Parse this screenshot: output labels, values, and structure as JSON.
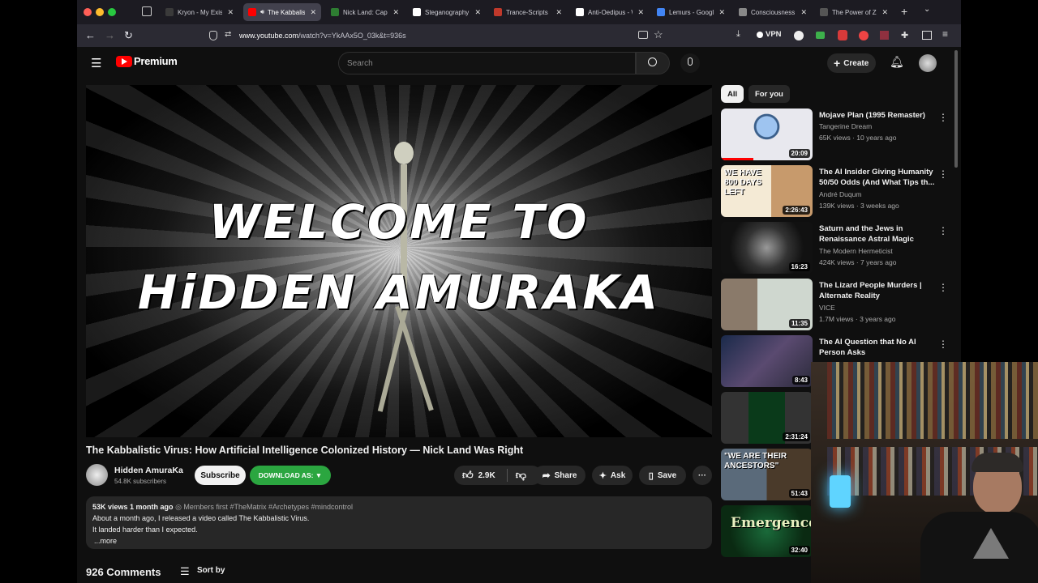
{
  "tabs": [
    {
      "title": "Kryon - My Existe",
      "color": "#3a3a3a"
    },
    {
      "title": "The Kabbalis",
      "color": "#ff0000"
    },
    {
      "title": "Nick Land: Capit",
      "color": "#2e7d32"
    },
    {
      "title": "Steganography -",
      "color": "#ffffff"
    },
    {
      "title": "Trance-Scripts",
      "color": "#c0392b"
    },
    {
      "title": "Anti-Oedipus - W",
      "color": "#ffffff"
    },
    {
      "title": "Lemurs - Google",
      "color": "#4285f4"
    },
    {
      "title": "Consciousness I",
      "color": "#888888"
    },
    {
      "title": "The Power of Zero -",
      "color": "#555555"
    }
  ],
  "browser": {
    "url_host": "www.youtube.com",
    "url_path": "/watch?v=YkAAx5O_03k&t=936s",
    "vpn_label": "VPN"
  },
  "youtube": {
    "logo_text": "Premium",
    "search_placeholder": "Search",
    "create_label": "Create"
  },
  "player": {
    "line1": "WELCOME TO",
    "line2": "HiDDEN AMURAKA"
  },
  "video": {
    "title": "The Kabbalistic Virus: How Artificial Intelligence Colonized History — Nick Land Was Right",
    "channel": "Hidden AmuraKa",
    "subscribers": "54.8K subscribers",
    "subscribe_label": "Subscribe",
    "download_label": "DOWNLOAD AS: ▼",
    "likes": "2.9K",
    "share_label": "Share",
    "ask_label": "Ask",
    "save_label": "Save",
    "views": "53K views",
    "age": "1 month ago",
    "members": "Members first",
    "hashtags": "#TheMatrix #Archetypes #mindcontrol",
    "desc_line1": "About a month ago, I released a video called The Kabbalistic Virus.",
    "desc_line2": "It landed harder than I expected.",
    "more_label": "...more",
    "comments_count": "926 Comments",
    "sort_label": "Sort by"
  },
  "chips": [
    "All",
    "For you"
  ],
  "recommendations": [
    {
      "title": "Mojave Plan (1995 Remaster)",
      "channel": "Tangerine Dream",
      "meta": "65K views · 10 years ago",
      "duration": "20:09"
    },
    {
      "title": "The AI Insider Giving Humanity 50/50 Odds (And What Tips th...",
      "channel": "André Duqum",
      "meta": "139K views · 3 weeks ago",
      "duration": "2:26:43",
      "thumb_text1": "WE HAVE",
      "thumb_text2": "800 DAYS",
      "thumb_text3": "LEFT"
    },
    {
      "title": "Saturn and the Jews in Renaissance Astral Magic",
      "channel": "The Modern Hermeticist",
      "meta": "424K views · 7 years ago",
      "duration": "16:23"
    },
    {
      "title": "The Lizard People Murders | Alternate Reality",
      "channel": "VICE",
      "meta": "1.7M views · 3 years ago",
      "duration": "11:35"
    },
    {
      "title": "The AI Question that No AI Person Asks",
      "channel": "",
      "meta": "",
      "duration": "8:43"
    },
    {
      "title": "",
      "channel": "",
      "meta": "",
      "duration": "2:31:24"
    },
    {
      "title": "",
      "channel": "",
      "meta": "",
      "duration": "51:43",
      "thumb_text1": "\"WE ARE THEIR",
      "thumb_text2": "ANCESTORS\""
    },
    {
      "title": "",
      "channel": "",
      "meta": "",
      "duration": "32:40",
      "thumb_text1": "Emergence"
    }
  ]
}
